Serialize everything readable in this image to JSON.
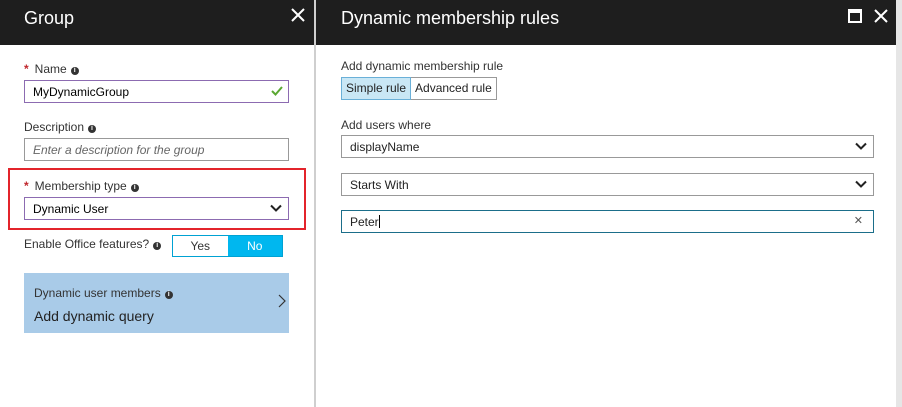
{
  "left_blade": {
    "title": "Group",
    "name_label": "Name",
    "name_value": "MyDynamicGroup",
    "description_label": "Description",
    "description_placeholder": "Enter a description for the group",
    "membership_label": "Membership type",
    "membership_value": "Dynamic User",
    "office_label": "Enable Office features?",
    "office_yes": "Yes",
    "office_no": "No",
    "office_selected": "No",
    "dynamic_card_label": "Dynamic user members",
    "dynamic_card_value": "Add dynamic query"
  },
  "right_blade": {
    "title": "Dynamic membership rules",
    "rule_label": "Add dynamic membership rule",
    "tab_simple": "Simple rule",
    "tab_advanced": "Advanced rule",
    "tab_selected": "Simple rule",
    "users_label": "Add users where",
    "property_value": "displayName",
    "operator_value": "Starts With",
    "value_text": "Peter"
  },
  "colors": {
    "header_bg": "#1e1e1e",
    "accent_blue": "#00b7ef",
    "card_bg": "#a9cbe8",
    "highlight_red": "#e3242b",
    "required_red": "#c0272d",
    "valid_green": "#5aa832"
  },
  "icons": {
    "close": "close-icon",
    "maximize": "maximize-icon",
    "check": "check-icon",
    "info": "info-icon",
    "chevron_down": "chevron-down-icon",
    "chevron_right": "chevron-right-icon",
    "clear": "clear-icon"
  }
}
